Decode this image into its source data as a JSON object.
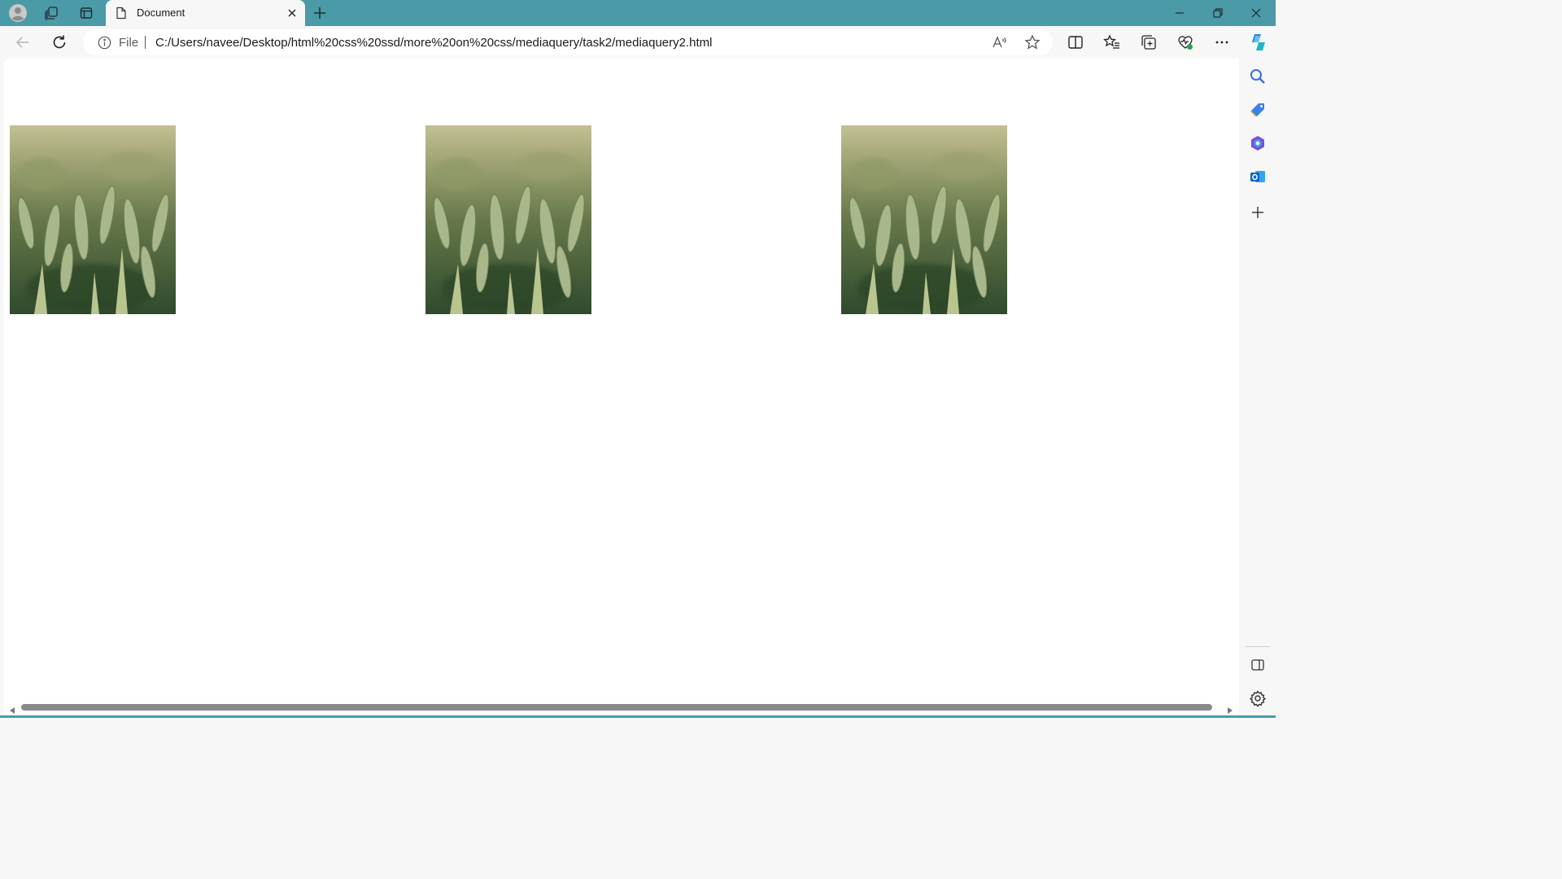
{
  "window": {
    "accent_color": "#4a9aa8"
  },
  "titlebar": {
    "icons": [
      "profile-icon",
      "workspaces-icon",
      "tab-actions-icon"
    ],
    "tab": {
      "title": "Document",
      "icon": "document-icon"
    },
    "new_tab_icon": "plus-icon",
    "controls": [
      "minimize-icon",
      "restore-icon",
      "close-icon"
    ]
  },
  "toolbar": {
    "back_icon": "arrow-left-icon",
    "refresh_icon": "refresh-icon",
    "address": {
      "scheme_label": "File",
      "url": "C:/Users/navee/Desktop/html%20css%20ssd/more%20on%20css/mediaquery/task2/mediaquery2.html"
    },
    "actions": [
      "read-aloud-icon",
      "favorite-star-icon",
      "split-screen-icon",
      "favorites-icon",
      "collections-icon",
      "browser-essentials-icon",
      "more-icon",
      "copilot-icon"
    ]
  },
  "page": {
    "images": [
      {
        "alt": "wheat field"
      },
      {
        "alt": "wheat field"
      },
      {
        "alt": "wheat field"
      }
    ]
  },
  "sidebar": {
    "items": [
      "search-icon",
      "shopping-tag-icon",
      "office-icon",
      "outlook-icon",
      "add-icon"
    ],
    "bottom_items": [
      "sidebar-toggle-icon",
      "settings-icon"
    ]
  }
}
